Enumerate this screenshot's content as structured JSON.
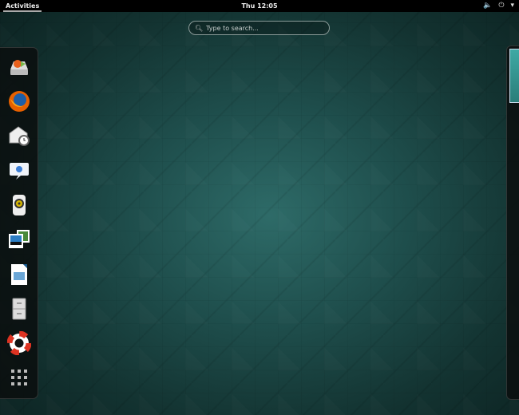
{
  "topbar": {
    "activities": "Activities",
    "clock": "Thu 12:05",
    "volume_icon": "speaker-icon",
    "power_icon": "power-icon",
    "menu_arrow": "▾"
  },
  "search": {
    "placeholder": "Type to search..."
  },
  "dock": {
    "items": [
      {
        "name": "install-to-hard-drive",
        "icon": "installer-icon"
      },
      {
        "name": "firefox",
        "icon": "firefox-icon"
      },
      {
        "name": "evolution",
        "icon": "mail-clock-icon"
      },
      {
        "name": "empathy",
        "icon": "chat-icon"
      },
      {
        "name": "rhythmbox",
        "icon": "speaker-app-icon"
      },
      {
        "name": "shotwell",
        "icon": "photos-icon"
      },
      {
        "name": "libreoffice-impress",
        "icon": "impress-icon"
      },
      {
        "name": "files",
        "icon": "file-cabinet-icon"
      },
      {
        "name": "help",
        "icon": "lifebuoy-icon"
      },
      {
        "name": "show-applications",
        "icon": "grid-icon"
      }
    ]
  },
  "colors": {
    "accent": "#2e6b68",
    "topbar": "#000000"
  }
}
